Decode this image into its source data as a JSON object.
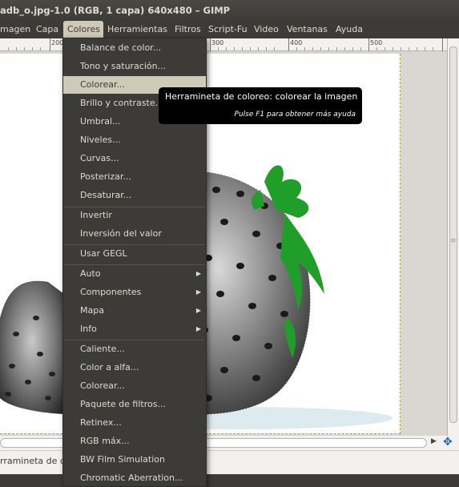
{
  "window": {
    "title": "adb_o.jpg-1.0 (RGB, 1 capa) 640x480 – GIMP"
  },
  "menubar": {
    "items": [
      {
        "label": "magen"
      },
      {
        "label": "Capa"
      },
      {
        "label": "Colores"
      },
      {
        "label": "Herramientas"
      },
      {
        "label": "Filtros"
      },
      {
        "label": "Script-Fu"
      },
      {
        "label": "Video"
      },
      {
        "label": "Ventanas"
      },
      {
        "label": "Ayuda"
      }
    ]
  },
  "ruler": {
    "labels": [
      "200",
      "300",
      "400",
      "500",
      "600"
    ]
  },
  "colors_menu": {
    "items": [
      {
        "label": "Balance de color..."
      },
      {
        "label": "Tono y saturación..."
      },
      {
        "label": "Colorear..."
      },
      {
        "label": "Brillo y contraste..."
      },
      {
        "label": "Umbral..."
      },
      {
        "label": "Niveles..."
      },
      {
        "label": "Curvas..."
      },
      {
        "label": "Posterizar..."
      },
      {
        "label": "Desaturar..."
      },
      {
        "label": "Invertir"
      },
      {
        "label": "Inversión del valor"
      },
      {
        "label": "Usar GEGL"
      },
      {
        "label": "Auto"
      },
      {
        "label": "Componentes"
      },
      {
        "label": "Mapa"
      },
      {
        "label": "Info"
      },
      {
        "label": "Caliente..."
      },
      {
        "label": "Color a alfa..."
      },
      {
        "label": "Colorear..."
      },
      {
        "label": "Paquete de filtros..."
      },
      {
        "label": "Retinex..."
      },
      {
        "label": "RGB máx..."
      },
      {
        "label": "BW Film Simulation"
      },
      {
        "label": "Chromatic Aberration..."
      }
    ]
  },
  "tooltip": {
    "title": "Herramineta de coloreo: colorear la imagen",
    "help": "Pulse F1 para obtener más ayuda"
  },
  "statusbar": {
    "text": "rramineta de c"
  },
  "theme": {
    "menu_bg": "#3c3b37",
    "highlight": "#cfc9b7",
    "text": "#dfdbd2",
    "leaf_green": "#1f9e2a"
  }
}
